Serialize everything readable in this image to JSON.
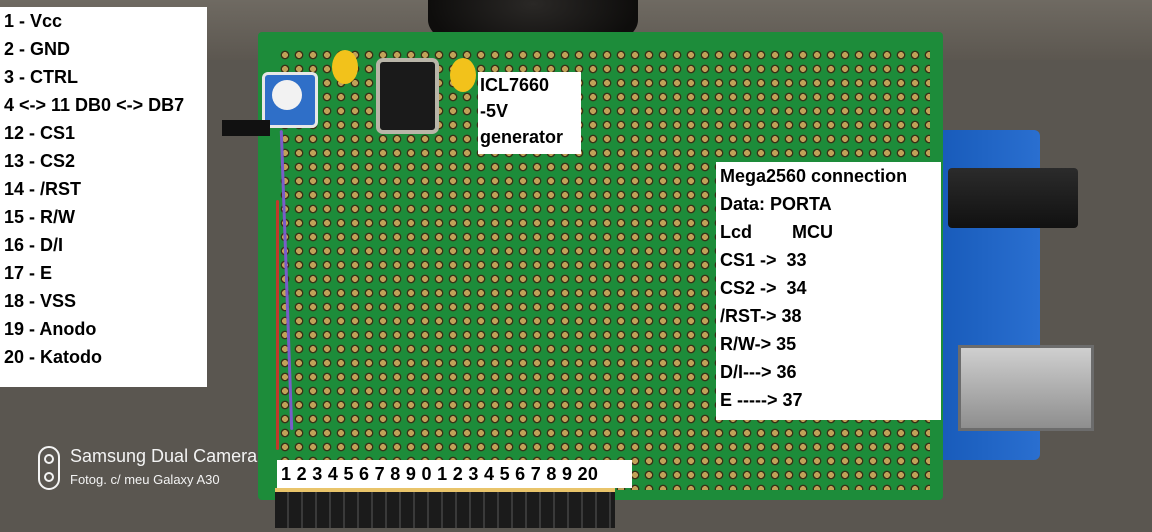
{
  "pin_list": [
    "1 - Vcc",
    "2 - GND",
    "3 - CTRL",
    "4 <-> 11 DB0 <-> DB7",
    "12 - CS1",
    "13 - CS2",
    "14 - /RST",
    "15 - R/W",
    "16 - D/I",
    "17 - E",
    "18 - VSS",
    "19 - Anodo",
    "20 - Katodo"
  ],
  "icl_label": [
    "ICL7660",
    "-5V",
    "generator"
  ],
  "mega_connection": [
    "Mega2560 connection",
    "Data: PORTA",
    "Lcd        MCU",
    "CS1 ->  33",
    "CS2 ->  34",
    "/RST-> 38",
    "R/W-> 35",
    "D/I---> 36",
    "E -----> 37"
  ],
  "pin_numbers": "1 2 3 4 5 6 7 8 9 0 1 2 3 4 5 6 7 8 9 20",
  "watermark": {
    "title": "Samsung Dual Camera",
    "subtitle": "Fotog. c/ meu Galaxy A30",
    "icon": "dual-camera-icon"
  }
}
